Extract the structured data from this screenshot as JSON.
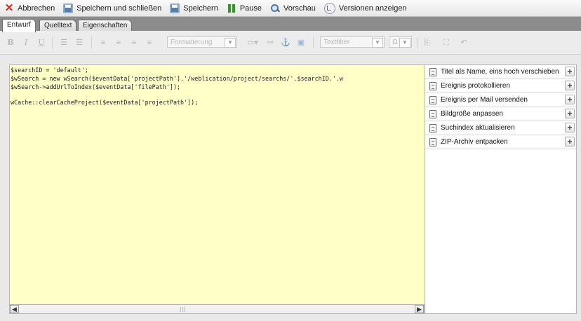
{
  "toolbar": {
    "cancel": "Abbrechen",
    "save_close": "Speichern und schließen",
    "save": "Speichern",
    "pause": "Pause",
    "preview": "Vorschau",
    "versions": "Versionen anzeigen"
  },
  "tabs": [
    {
      "label": "Entwurf",
      "active": true
    },
    {
      "label": "Quelltext",
      "active": false
    },
    {
      "label": "Eigenschaften",
      "active": false
    }
  ],
  "format_toolbar": {
    "bold": "B",
    "italic": "I",
    "underline": "U",
    "format_select": "Formatierung",
    "text_filter_select": "Textfilter",
    "special_char": "Ω"
  },
  "editor": {
    "lines": [
      "$searchID = 'default';",
      "$wSearch = new wSearch($eventData['projectPath'].'/weblication/project/searchs/'.$searchID.'.w",
      "$wSearch->addUrlToIndex($eventData['filePath']);",
      "wCache::clearCacheProject($eventData['projectPath']);"
    ]
  },
  "actions": [
    {
      "label": "Titel als Name, eins hoch verschieben"
    },
    {
      "label": "Ereignis protokollieren"
    },
    {
      "label": "Ereignis per Mail versenden"
    },
    {
      "label": "Bildgröße anpassen"
    },
    {
      "label": "Suchindex aktualisieren"
    },
    {
      "label": "ZIP-Archiv entpacken"
    }
  ],
  "colors": {
    "editor_bg": "#ffffc8",
    "cancel_icon": "#d0261b",
    "pause_icon": "#2f9a1f"
  }
}
